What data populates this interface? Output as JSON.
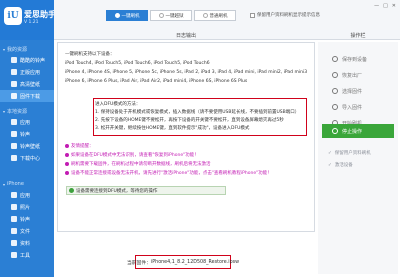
{
  "brand": {
    "name": "爱思助手",
    "version": "V 1.21",
    "logo_text": "iU"
  },
  "sidebar": {
    "sections": [
      {
        "label": "我的资源",
        "items": [
          "酷酷的铃声",
          "正版应用",
          "高清壁纸",
          "固件下载"
        ]
      },
      {
        "label": "本地资源",
        "items": [
          "应用",
          "铃声",
          "铃声壁纸",
          "下载中心"
        ]
      },
      {
        "label": "iPhone",
        "items": [
          "应用",
          "照片",
          "铃声",
          "文件",
          "资料",
          "工具"
        ]
      }
    ],
    "active_item": "固件下载"
  },
  "toolbar": {
    "modes": [
      "一键刷机",
      "一键越狱",
      "普通刷机"
    ],
    "active_mode": "一键刷机",
    "checkbox_label": "保留用户资料刷机显示提示信息",
    "window_controls": [
      "—",
      "□",
      "✕"
    ]
  },
  "headers": {
    "log": "日志输出",
    "ops": "操作栏"
  },
  "log": {
    "intro": "—键刷机支持以下设备：",
    "device_lines": [
      "iPod Touch4, iPod Touch5, iPod Touch6, iPod Touch5, iPod Touch6",
      "iPhone 4, iPhone 4S, iPhone 5, iPhone 5c, iPhone 5s, iPad 2, iPad 3, iPad 4, iPad mini, iPad mini2, iPad mini3",
      "iPhone 6, iPhone 6 Plus, iPad Air, iPad Air2, iPad mini4, iPhone 6S, iPhone 6S Plus"
    ],
    "dfu_title": "进入DFU模式的方法：",
    "dfu_steps": [
      "1. 保持设备处于开机模式或恢复模式，插入数据线（请不要使用USB延长线，不要插到前置USB端口）",
      "2. 先按下设备的HOME键不要松开，再按下设备的开关键不要松开，直到设备屏幕熄灭再过5秒",
      "3. 松开开关键，继续按住HOME键，直到软件提示\"成功\"，设备进入DFU模式"
    ],
    "help_title": "友情提醒：",
    "help_lines": [
      "如果设备在DFU模式中无法识别，请查看\"恢复到iPhone\"功能！",
      "刷机需要下载固件，在刷机过程中请勿断开数据线，刷机后将无法激活",
      "设备不能正常连接或设备无法开机，请先进行\"激活iPhone\"功能，点击\"查看刷机教程iPhone\"功能！"
    ],
    "status": "设备需要连接到DFU模式，等待您的操作"
  },
  "firmware": {
    "label": "当前固件：",
    "file": "iPhone4,1_8.2_12D508_Restore.ipsw"
  },
  "ops": {
    "buttons": [
      "保存到设备",
      "恢复出厂",
      "选择固件",
      "导入固件",
      "开始刷机",
      "停止操作"
    ],
    "active_button": "停止操作",
    "links": [
      "保留用户资料刷机",
      "激活设备"
    ]
  },
  "colors": {
    "sidebar": "#2b7fd4",
    "accent_green": "#3aa63a",
    "highlight_red": "#d0021b",
    "tip_pink": "#c21bb3"
  }
}
